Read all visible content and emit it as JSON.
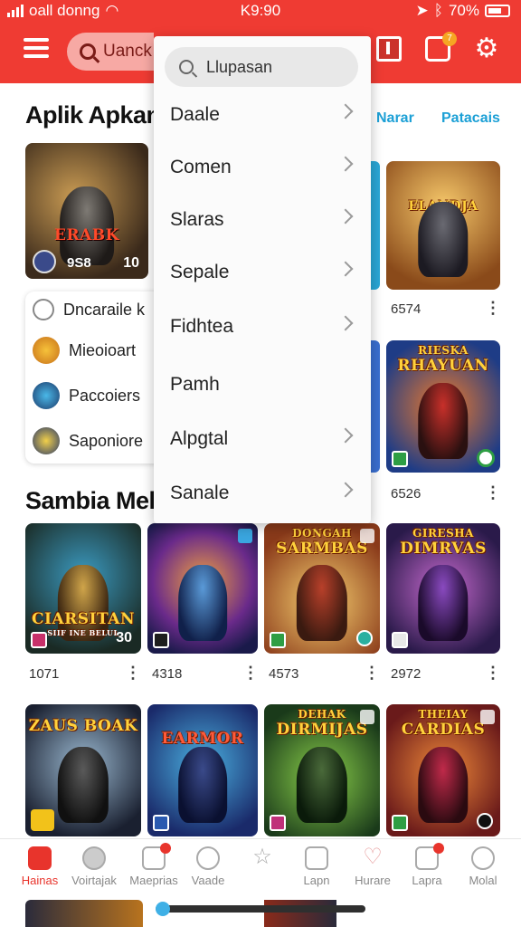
{
  "status": {
    "carrier": "oall donng",
    "time": "K9:90",
    "battery": "70%"
  },
  "header": {
    "search_text": "Uanck",
    "notif_badge": "7",
    "colors": {
      "bar": "#ef3b33",
      "accent": "#1ca0d6"
    }
  },
  "dropdown": {
    "search_placeholder": "Llupasan",
    "items": [
      {
        "label": "Daale",
        "chevron": true
      },
      {
        "label": "Comen",
        "chevron": true
      },
      {
        "label": "Slaras",
        "chevron": true
      },
      {
        "label": "Sepale",
        "chevron": true
      },
      {
        "label": "Fidhtea",
        "chevron": true
      },
      {
        "label": "Pamh",
        "chevron": false
      },
      {
        "label": "Alpgtal",
        "chevron": true
      },
      {
        "label": "Sanale",
        "chevron": true
      }
    ]
  },
  "section1": {
    "title": "Aplik Apkan",
    "links": [
      "Narar",
      "Patacais"
    ],
    "tile1": {
      "art_title": "ERABK",
      "badge_left": "9S8",
      "number": "10"
    },
    "right_tile_a": {
      "art_title": "ELANDJA",
      "count": "6574"
    },
    "right_tile_b": {
      "art_title": "RHAYUAN",
      "art_sub": "RIESKA",
      "count": "6526"
    }
  },
  "card_list": [
    {
      "label": "Dncaraile k",
      "icon": "radio-icon"
    },
    {
      "label": "Mieoioart",
      "icon": "app-icon"
    },
    {
      "label": "Paccoiers",
      "icon": "app-icon"
    },
    {
      "label": "Saponiore",
      "icon": "app-icon"
    }
  ],
  "section2": {
    "title": "Sambia Melun",
    "row1": [
      {
        "art_title": "CIARSITAN",
        "art_sub": "SIIF INE BELUL",
        "count": "1071",
        "num": "30"
      },
      {
        "art_title": "",
        "count": "4318"
      },
      {
        "art_title": "SARMBAS",
        "art_sub": "DONGAH",
        "count": "4573"
      },
      {
        "art_title": "DIMRVAS",
        "art_sub": "GIRESHA",
        "count": "2972"
      }
    ],
    "row2": [
      {
        "art_title": "ZAUS BOAK"
      },
      {
        "art_title": "EARMOR"
      },
      {
        "art_title": "DIRMIJAS",
        "art_sub": "DEHAK"
      },
      {
        "art_title": "CARDIAS",
        "art_sub": "THEIAY"
      }
    ]
  },
  "bottom_nav": [
    {
      "label": "Hainas",
      "icon": "home-icon",
      "active": true
    },
    {
      "label": "Voirtajak",
      "icon": "tag-icon",
      "active": false
    },
    {
      "label": "Maeprias",
      "icon": "games-icon",
      "active": false
    },
    {
      "label": "Vaade",
      "icon": "clock-icon",
      "active": false
    },
    {
      "label": "",
      "icon": "star-icon",
      "active": false
    },
    {
      "label": "Lapn",
      "icon": "shield-icon",
      "active": false
    },
    {
      "label": "Hurare",
      "icon": "heart-icon",
      "active": false
    },
    {
      "label": "Lapra",
      "icon": "inbox-icon",
      "active": false
    },
    {
      "label": "Molal",
      "icon": "person-icon",
      "active": false
    }
  ]
}
